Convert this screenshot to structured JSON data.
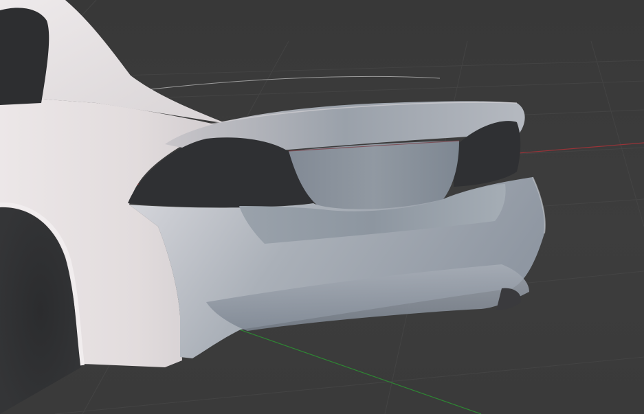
{
  "viewport": {
    "background_color": "#3d3d3d",
    "grid_color": "#484848",
    "axis_x_color": "#a0353a",
    "axis_y_color": "#2f8a34"
  },
  "model": {
    "body_color": "#e7e2e3",
    "shadow_color": "#687280",
    "cavity_color": "#2f3033"
  }
}
